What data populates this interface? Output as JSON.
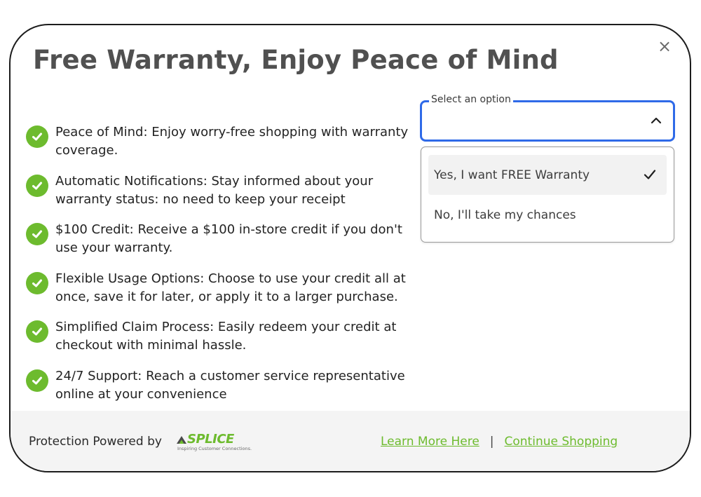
{
  "modal": {
    "title": "Free Warranty, Enjoy Peace of Mind",
    "close_label": "×"
  },
  "benefits": [
    {
      "text": "Peace of Mind: Enjoy worry-free shopping with warranty coverage."
    },
    {
      "text": "Automatic Notifications: Stay informed about your warranty status: no need to keep your receipt"
    },
    {
      "text": "$100 Credit: Receive a $100 in-store credit if you don't use your warranty."
    },
    {
      "text": "Flexible Usage Options: Choose to use your credit all at once, save it for later, or apply it to a larger purchase."
    },
    {
      "text": "Simplified Claim Process: Easily redeem your credit at checkout with minimal hassle."
    },
    {
      "text": "24/7 Support: Reach a customer service representative online at your convenience"
    }
  ],
  "select": {
    "label": "Select an option",
    "value": "",
    "options": [
      {
        "label": "Yes, I want FREE Warranty",
        "selected": true
      },
      {
        "label": "No, I'll take my chances",
        "selected": false
      }
    ]
  },
  "footer": {
    "powered_by": "Protection Powered by",
    "logo": {
      "name": "SPLICE",
      "tagline": "Inspiring Customer Connections."
    },
    "learn_more": "Learn More Here",
    "separator": "|",
    "continue": "Continue Shopping"
  },
  "colors": {
    "accent_green": "#6dbb2e",
    "focus_blue": "#2f6ae8",
    "title_gray": "#505050"
  },
  "icons": {
    "close": "close-icon",
    "benefit": "check-circle-icon",
    "select": "chevron-up-icon",
    "selected_option": "checkmark-icon"
  }
}
